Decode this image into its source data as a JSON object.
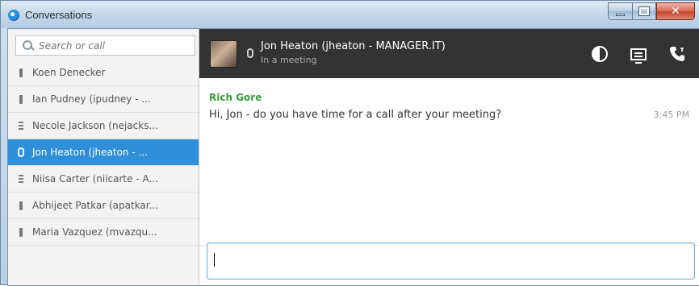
{
  "window": {
    "title": "Conversations"
  },
  "search": {
    "placeholder": "Search or call"
  },
  "contacts": [
    {
      "label": "Koen Denecker",
      "status_icon": "presence-bar-icon",
      "selected": false
    },
    {
      "label": "Ian Pudney (ipudney - ...",
      "status_icon": "presence-bar-icon",
      "selected": false
    },
    {
      "label": "Necole Jackson (nejacks...",
      "status_icon": "phone-presence-icon",
      "selected": false
    },
    {
      "label": "Jon Heaton (jheaton - ...",
      "status_icon": "in-meeting-icon",
      "selected": true
    },
    {
      "label": "Niisa Carter (niicarte - A...",
      "status_icon": "phone-presence-icon",
      "selected": false
    },
    {
      "label": "Abhijeet Patkar (apatkar...",
      "status_icon": "presence-bar-icon",
      "selected": false
    },
    {
      "label": "Maria Vazquez (mvazqu...",
      "status_icon": "presence-bar-icon",
      "selected": false
    }
  ],
  "conversation": {
    "name": "Jon Heaton (jheaton - MANAGER.IT)",
    "status": "In a meeting",
    "actions": [
      "contrast-icon",
      "screen-share-icon",
      "phone-call-icon"
    ]
  },
  "messages": [
    {
      "sender": "Rich Gore",
      "text": "Hi, Jon - do you have time for a call after your meeting?",
      "time": "3:45 PM"
    }
  ],
  "composer": {
    "tools": [
      "screenshot-snip-icon",
      "attachment-icon",
      "emoticon-icon",
      "text-format-icon",
      "add-participant-icon"
    ],
    "value": ""
  },
  "colors": {
    "selection": "#2f8fd8",
    "header_bg": "#333333",
    "sender_name": "#3a9a3a"
  }
}
